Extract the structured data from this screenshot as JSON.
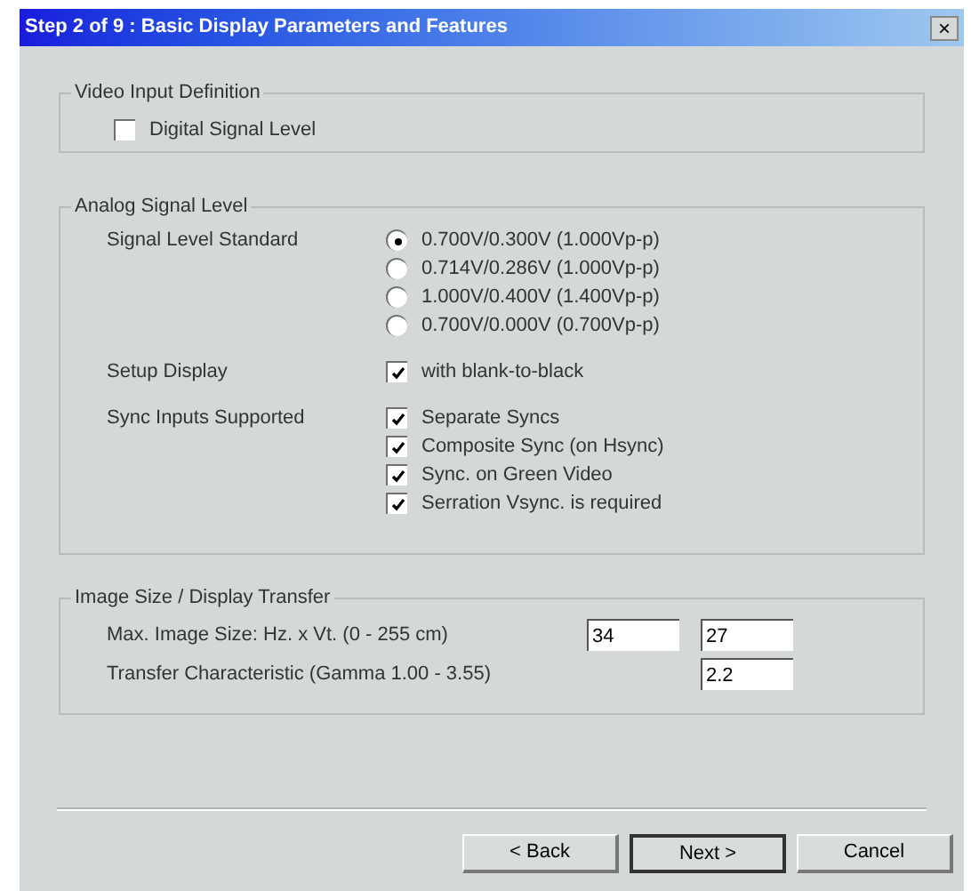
{
  "window": {
    "title": "Step 2 of 9 : Basic Display Parameters and Features",
    "close": "×"
  },
  "video_input": {
    "title": "Video Input Definition",
    "checkbox": {
      "label": "Digital Signal Level",
      "checked": false
    }
  },
  "analog": {
    "title": "Analog Signal Level",
    "signal_level": {
      "label": "Signal Level Standard",
      "options": [
        {
          "label": "0.700V/0.300V (1.000Vp-p)",
          "selected": true
        },
        {
          "label": "0.714V/0.286V (1.000Vp-p)",
          "selected": false
        },
        {
          "label": "1.000V/0.400V (1.400Vp-p)",
          "selected": false
        },
        {
          "label": "0.700V/0.000V (0.700Vp-p)",
          "selected": false
        }
      ]
    },
    "setup_display": {
      "label": "Setup Display",
      "checkbox": {
        "label": "with blank-to-black",
        "checked": true
      }
    },
    "sync_inputs": {
      "label": "Sync Inputs Supported",
      "checkboxes": [
        {
          "label": "Separate Syncs",
          "checked": true
        },
        {
          "label": "Composite Sync (on Hsync)",
          "checked": true
        },
        {
          "label": "Sync. on Green Video",
          "checked": true
        },
        {
          "label": "Serration Vsync. is required",
          "checked": true
        }
      ]
    }
  },
  "image_size": {
    "title": "Image Size / Display Transfer",
    "max_size": {
      "label": "Max. Image Size: Hz. x Vt. (0 - 255 cm)",
      "horizontal": "34",
      "vertical": "27"
    },
    "transfer": {
      "label": "Transfer Characteristic (Gamma 1.00 - 3.55)",
      "value": "2.2"
    }
  },
  "buttons": [
    {
      "label": "< Back",
      "default": false
    },
    {
      "label": "Next >",
      "default": true
    },
    {
      "label": "Cancel",
      "default": false
    }
  ]
}
